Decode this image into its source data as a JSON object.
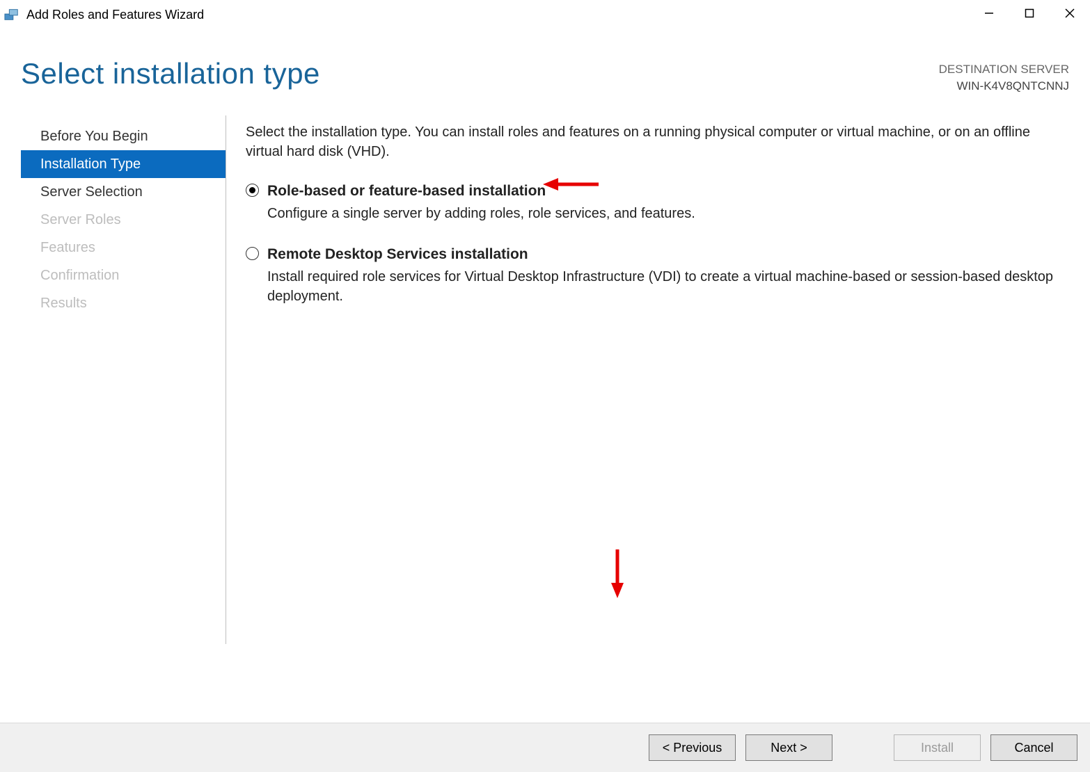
{
  "window": {
    "title": "Add Roles and Features Wizard"
  },
  "header": {
    "page_title": "Select installation type",
    "destination_label": "DESTINATION SERVER",
    "destination_name": "WIN-K4V8QNTCNNJ"
  },
  "sidebar": {
    "items": [
      {
        "label": "Before You Begin",
        "state": "enabled"
      },
      {
        "label": "Installation Type",
        "state": "selected"
      },
      {
        "label": "Server Selection",
        "state": "enabled"
      },
      {
        "label": "Server Roles",
        "state": "disabled"
      },
      {
        "label": "Features",
        "state": "disabled"
      },
      {
        "label": "Confirmation",
        "state": "disabled"
      },
      {
        "label": "Results",
        "state": "disabled"
      }
    ]
  },
  "content": {
    "instruction": "Select the installation type. You can install roles and features on a running physical computer or virtual machine, or on an offline virtual hard disk (VHD).",
    "options": [
      {
        "title": "Role-based or feature-based installation",
        "description": "Configure a single server by adding roles, role services, and features.",
        "checked": true
      },
      {
        "title": "Remote Desktop Services installation",
        "description": "Install required role services for Virtual Desktop Infrastructure (VDI) to create a virtual machine-based or session-based desktop deployment.",
        "checked": false
      }
    ]
  },
  "footer": {
    "previous": "< Previous",
    "next": "Next >",
    "install": "Install",
    "cancel": "Cancel"
  },
  "annotations": {
    "arrow_color": "#e60000"
  }
}
